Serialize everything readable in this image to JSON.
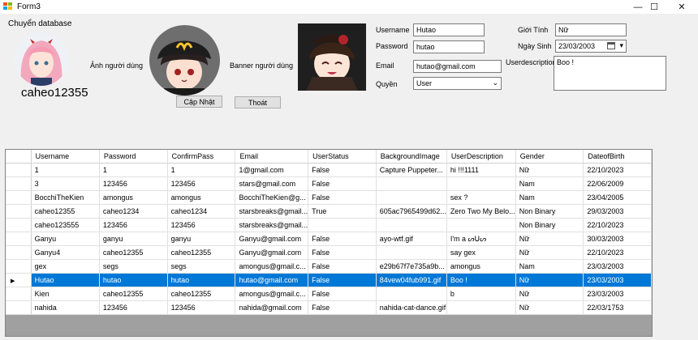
{
  "window": {
    "title": "Form3",
    "minimize": "—",
    "maximize": "☐",
    "close": "✕"
  },
  "menu": {
    "switch_db": "Chuyển database"
  },
  "profile": {
    "username_display": "caheo12355",
    "avatar_label": "Ảnh người dùng",
    "banner_label": "Banner người dùng",
    "update_button": "Cập Nhật",
    "exit_button": "Thoát"
  },
  "form": {
    "username_label": "Username",
    "username_value": "Hutao",
    "password_label": "Password",
    "password_value": "hutao",
    "email_label": "Email",
    "email_value": "hutao@gmail.com",
    "role_label": "Quyền",
    "role_value": "User",
    "gender_label": "Giới Tính",
    "gender_value": "Nữ",
    "dob_label": "Ngày Sinh",
    "dob_value": "23/03/2003",
    "desc_label": "Userdescription",
    "desc_value": "Boo !"
  },
  "grid": {
    "columns": [
      "Username",
      "Password",
      "ConfirmPass",
      "Email",
      "UserStatus",
      "BackgroundImage",
      "UserDescription",
      "Gender",
      "DateofBirth"
    ],
    "rows": [
      [
        "1",
        "1",
        "1",
        "1@gmail.com",
        "False",
        "Capture Puppeter...",
        "hi !!!1111",
        "Nữ",
        "22/10/2023"
      ],
      [
        "3",
        "123456",
        "123456",
        "stars@gmail.com",
        "False",
        "",
        "",
        "Nam",
        "22/06/2009"
      ],
      [
        "BocchiTheKien",
        "amongus",
        "amongus",
        "BocchiTheKien@g...",
        "False",
        "",
        "sex ?",
        "Nam",
        "23/04/2005"
      ],
      [
        "caheo12355",
        "caheo1234",
        "caheo1234",
        "starsbreaks@gmail...",
        "True",
        "605ac7965499d62...",
        "Zero Two My Belo...",
        "Non Binary",
        "29/03/2003"
      ],
      [
        "caheo123555",
        "123456",
        "123456",
        "starsbreaks@gmail...",
        "",
        "",
        "",
        "Non Binary",
        "22/10/2023"
      ],
      [
        "Ganyu",
        "ganyu",
        "ganyu",
        "Ganyu@gmail.com",
        "False",
        "ayo-wtf.gif",
        "I'm a ᔕᑌᔕ",
        "Nữ",
        "30/03/2003"
      ],
      [
        "Ganyu4",
        "caheo12355",
        "caheo12355",
        "Ganyu@gmail.com",
        "False",
        "",
        "say gex",
        "Nữ",
        "22/10/2023"
      ],
      [
        "gex",
        "segs",
        "segs",
        "amongus@gmail.c...",
        "False",
        "e29b67f7e735a9b...",
        "amongus",
        "Nam",
        "23/03/2003"
      ],
      [
        "Hutao",
        "hutao",
        "hutao",
        "hutao@gmail.com",
        "False",
        "84vew04fub991.gif",
        "Boo !",
        "Nữ",
        "23/03/2003"
      ],
      [
        "Kien",
        "caheo12355",
        "caheo12355",
        "amongus@gmail.c...",
        "False",
        "",
        "b",
        "Nữ",
        "23/03/2003"
      ],
      [
        "nahida",
        "123456",
        "123456",
        "nahida@gmail.com",
        "False",
        "nahida-cat-dance.gif",
        "",
        "Nữ",
        "22/03/1753"
      ]
    ],
    "selected_row": 8
  }
}
